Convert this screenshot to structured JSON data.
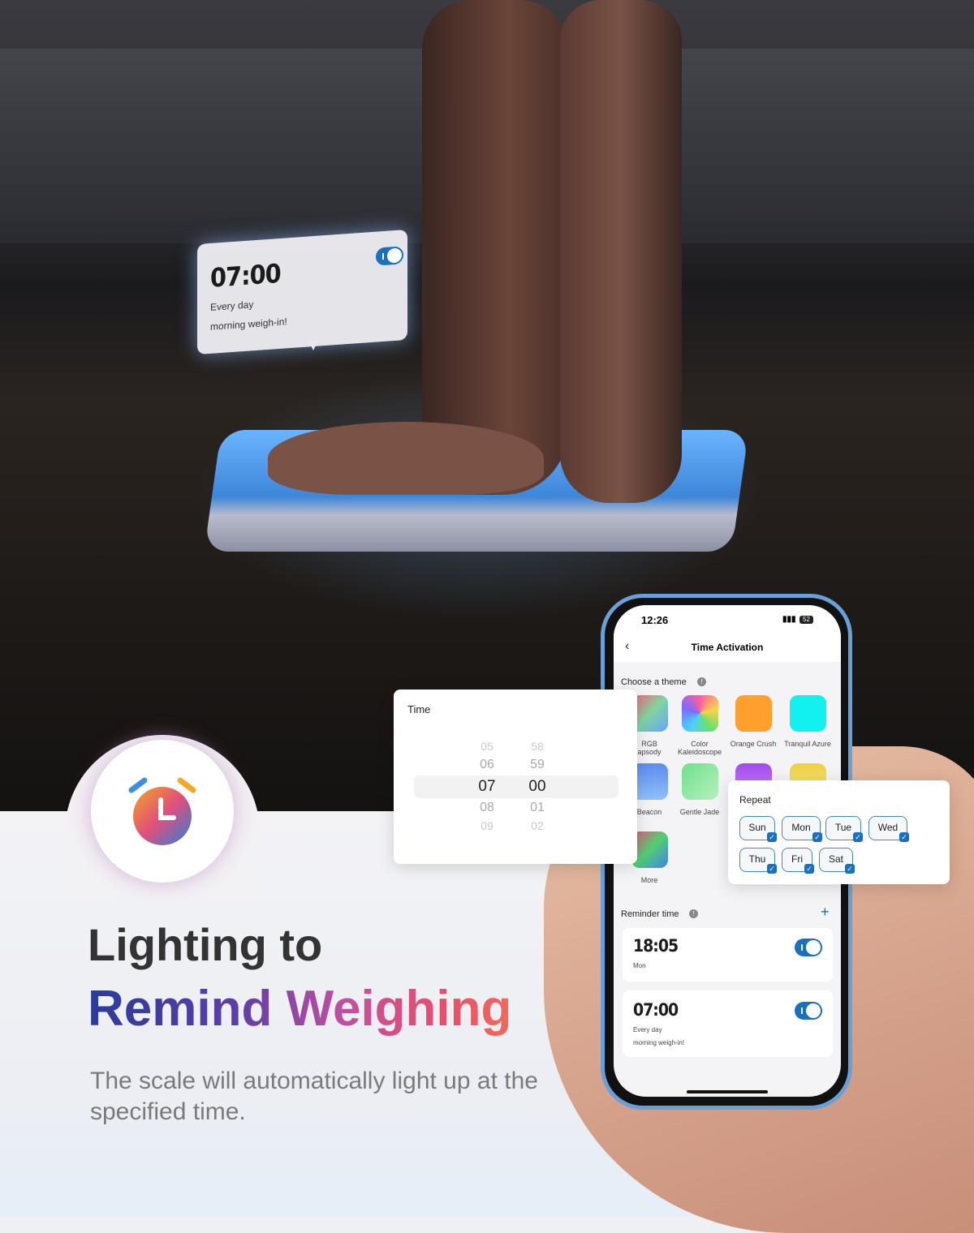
{
  "floating_card": {
    "time": "07:00",
    "repeat": "Every day",
    "label": "morning weigh-in!",
    "enabled": true
  },
  "headline": {
    "line1": "Lighting to",
    "line2": "Remind Weighing",
    "subtitle": "The scale will automatically light up at the specified time."
  },
  "phone": {
    "status": {
      "time": "12:26",
      "battery": "52"
    },
    "title": "Time Activation",
    "themes_label": "Choose a theme",
    "themes": [
      {
        "name": "RGB Rhapsody",
        "visible": "RGB\napsody"
      },
      {
        "name": "Color Kaleidoscope",
        "visible": "Color Kaleidoscope"
      },
      {
        "name": "Orange Crush",
        "visible": "Orange Crush",
        "color": "#ff9f2e"
      },
      {
        "name": "Tranquil Azure",
        "visible": "Tranquil Azure",
        "color": "#12f0f0"
      },
      {
        "name": "Beacon",
        "visible": "Beacon"
      },
      {
        "name": "Gentle Jade",
        "visible": "Gentle Jade"
      },
      {
        "name": "",
        "visible": ""
      },
      {
        "name": "",
        "visible": ""
      },
      {
        "name": "More",
        "visible": "More"
      }
    ],
    "reminder_label": "Reminder time",
    "reminders": [
      {
        "time": "18:05",
        "days": "Mon",
        "note": "",
        "enabled": true
      },
      {
        "time": "07:00",
        "days": "Every day",
        "note": "morning weigh-in!",
        "enabled": true
      }
    ]
  },
  "time_picker": {
    "title": "Time",
    "hours": [
      "05",
      "06",
      "07",
      "08",
      "09"
    ],
    "minutes": [
      "58",
      "59",
      "00",
      "01",
      "02"
    ],
    "selected": {
      "hour": "07",
      "minute": "00"
    }
  },
  "repeat": {
    "title": "Repeat",
    "days": [
      "Sun",
      "Mon",
      "Tue",
      "Wed",
      "Thu",
      "Fri",
      "Sat"
    ],
    "all_checked": true
  },
  "colors": {
    "accent": "#1a6fbf"
  }
}
